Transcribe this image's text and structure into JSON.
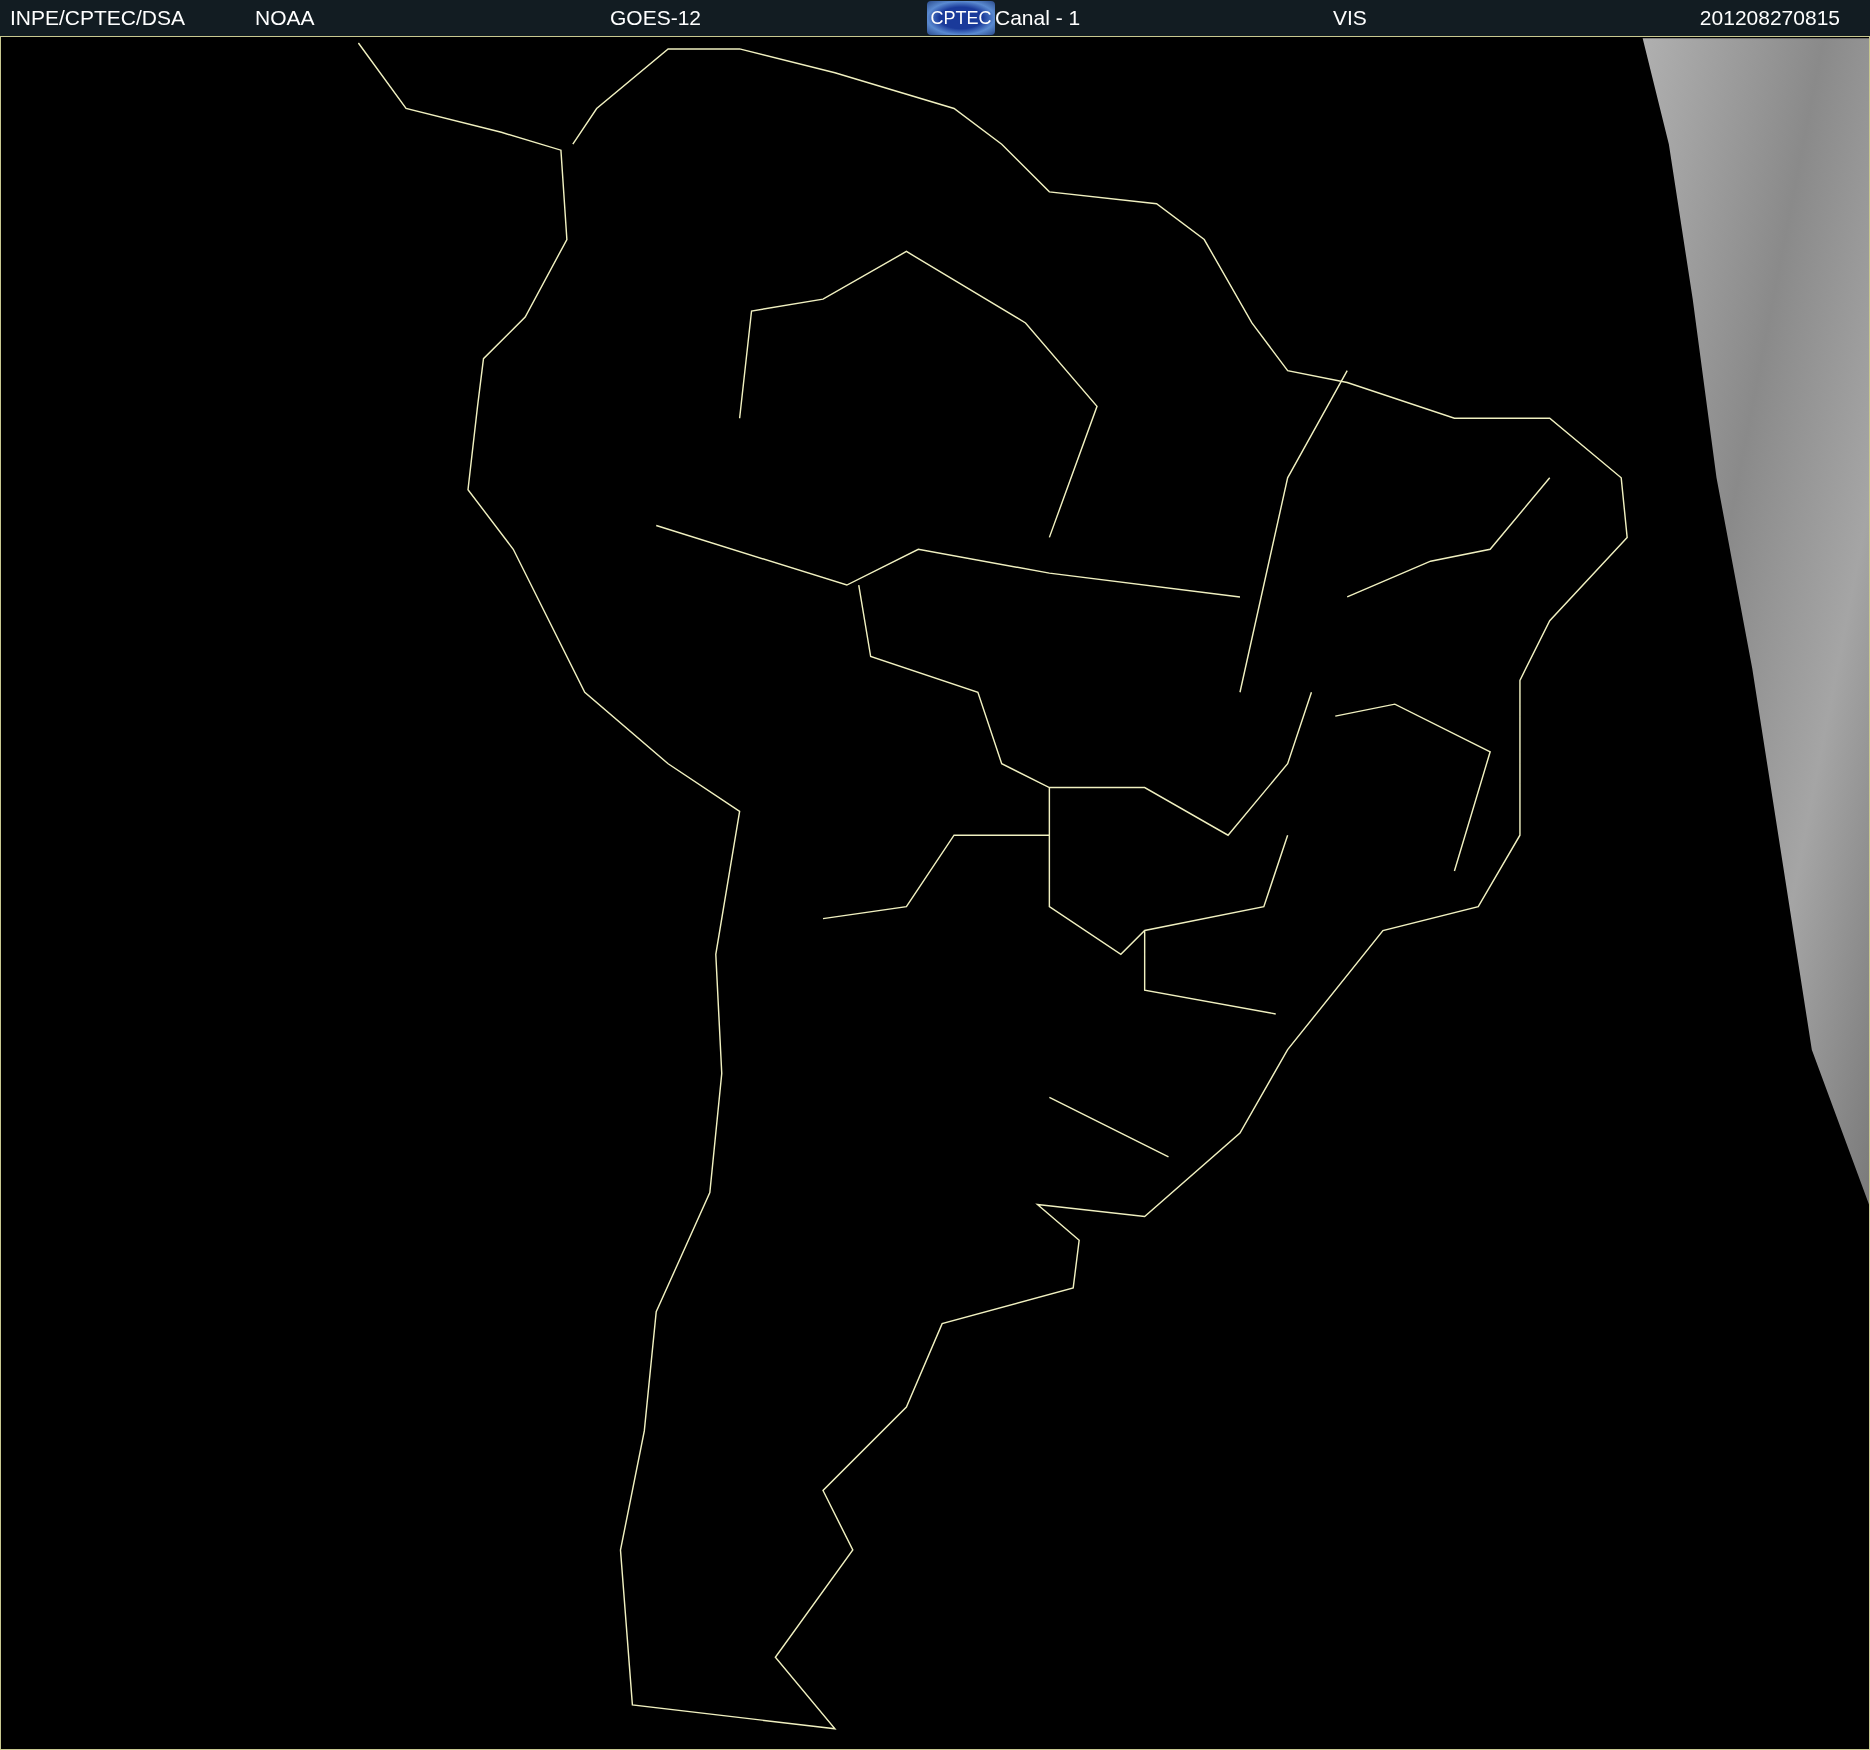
{
  "header": {
    "source": "INPE/CPTEC/DSA",
    "agency": "NOAA",
    "satellite": "GOES-12",
    "logo": "CPTEC",
    "channel": "Canal - 1",
    "band": "VIS",
    "timestamp": "201208270815"
  }
}
